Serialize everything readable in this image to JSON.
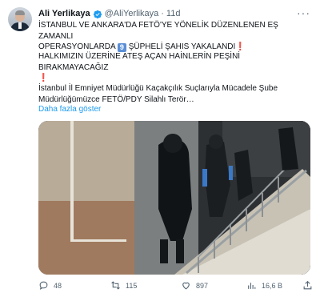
{
  "author": {
    "name": "Ali Yerlikaya",
    "handle": "@AliYerlikaya",
    "separator": "·",
    "time": "11d"
  },
  "more_label": "···",
  "tweet": {
    "line1": "İSTANBUL VE ANKARA'DA FETÖ'YE YÖNELİK DÜZENLENEN EŞ ZAMANLI",
    "line2_a": "OPERASYONLARDA",
    "count_badge": "9",
    "line2_b": "ŞÜPHELİ ŞAHIS YAKALANDI",
    "line3": "HALKIMIZIN ÜZERİNE ATEŞ AÇAN HAİNLERİN PEŞİNİ BIRAKMAYACAĞIZ",
    "line5": "İstanbul İl Emniyet Müdürlüğü Kaçakçılık Suçlarıyla Mücadele Şube",
    "line6": "Müdürlüğümüzce FETÖ/PDY Silahlı Terör…",
    "exclaim": "❗"
  },
  "show_more": "Daha fazla göster",
  "actions": {
    "replies": "48",
    "retweets": "115",
    "likes": "897",
    "views": "16,6 B"
  },
  "colors": {
    "accent": "#1d9bf0",
    "text_secondary": "#536471",
    "verified": "#1d9bf0"
  }
}
